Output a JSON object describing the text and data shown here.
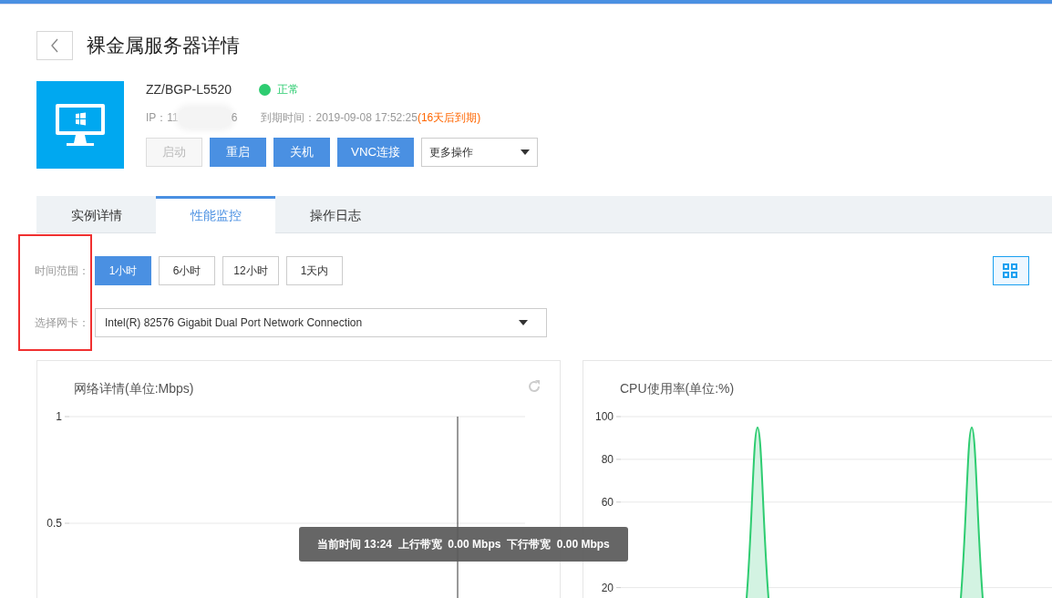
{
  "page": {
    "title": "裸金属服务器详情"
  },
  "server": {
    "name": "ZZ/BGP-L5520",
    "status": {
      "text": "正常",
      "kind": "ok"
    },
    "ip": {
      "start": "IP：11",
      "end": "6",
      "redacted": true
    },
    "expiry": "到期时间：2019-09-08 17:52:25",
    "expiry_note": "(16天后到期)",
    "actions": [
      {
        "label": "启动",
        "disabled": true
      },
      {
        "label": "重启",
        "disabled": false
      },
      {
        "label": "关机",
        "disabled": false
      },
      {
        "label": "VNC连接",
        "disabled": false
      }
    ],
    "more": {
      "label": "更多操作"
    }
  },
  "tabs": [
    {
      "label": "实例详情",
      "selected": false
    },
    {
      "label": "性能监控",
      "selected": true
    },
    {
      "label": "操作日志",
      "selected": false
    }
  ],
  "filters": {
    "highlighted": true,
    "time_label": "时间范围：",
    "ranges": [
      {
        "label": "1小时",
        "selected": true
      },
      {
        "label": "6小时",
        "selected": false
      },
      {
        "label": "12小时",
        "selected": false
      },
      {
        "label": "1天内",
        "selected": false
      }
    ],
    "nic_label": "选择网卡：",
    "nic": "Intel(R) 82576 Gigabit Dual Port Network Connection"
  },
  "charts": [
    {
      "kind": "network",
      "refresh": true,
      "title": "网络详情(单位:Mbps)",
      "y_labels": [
        "1",
        "0.5"
      ]
    },
    {
      "kind": "cpu",
      "title": "CPU使用率(单位:%)",
      "y_labels": [
        "100",
        "80",
        "60",
        "20"
      ]
    }
  ],
  "tooltip": {
    "text": "当前时间 13:24  上行带宽  0.00 Mbps  下行带宽  0.00 Mbps"
  }
}
